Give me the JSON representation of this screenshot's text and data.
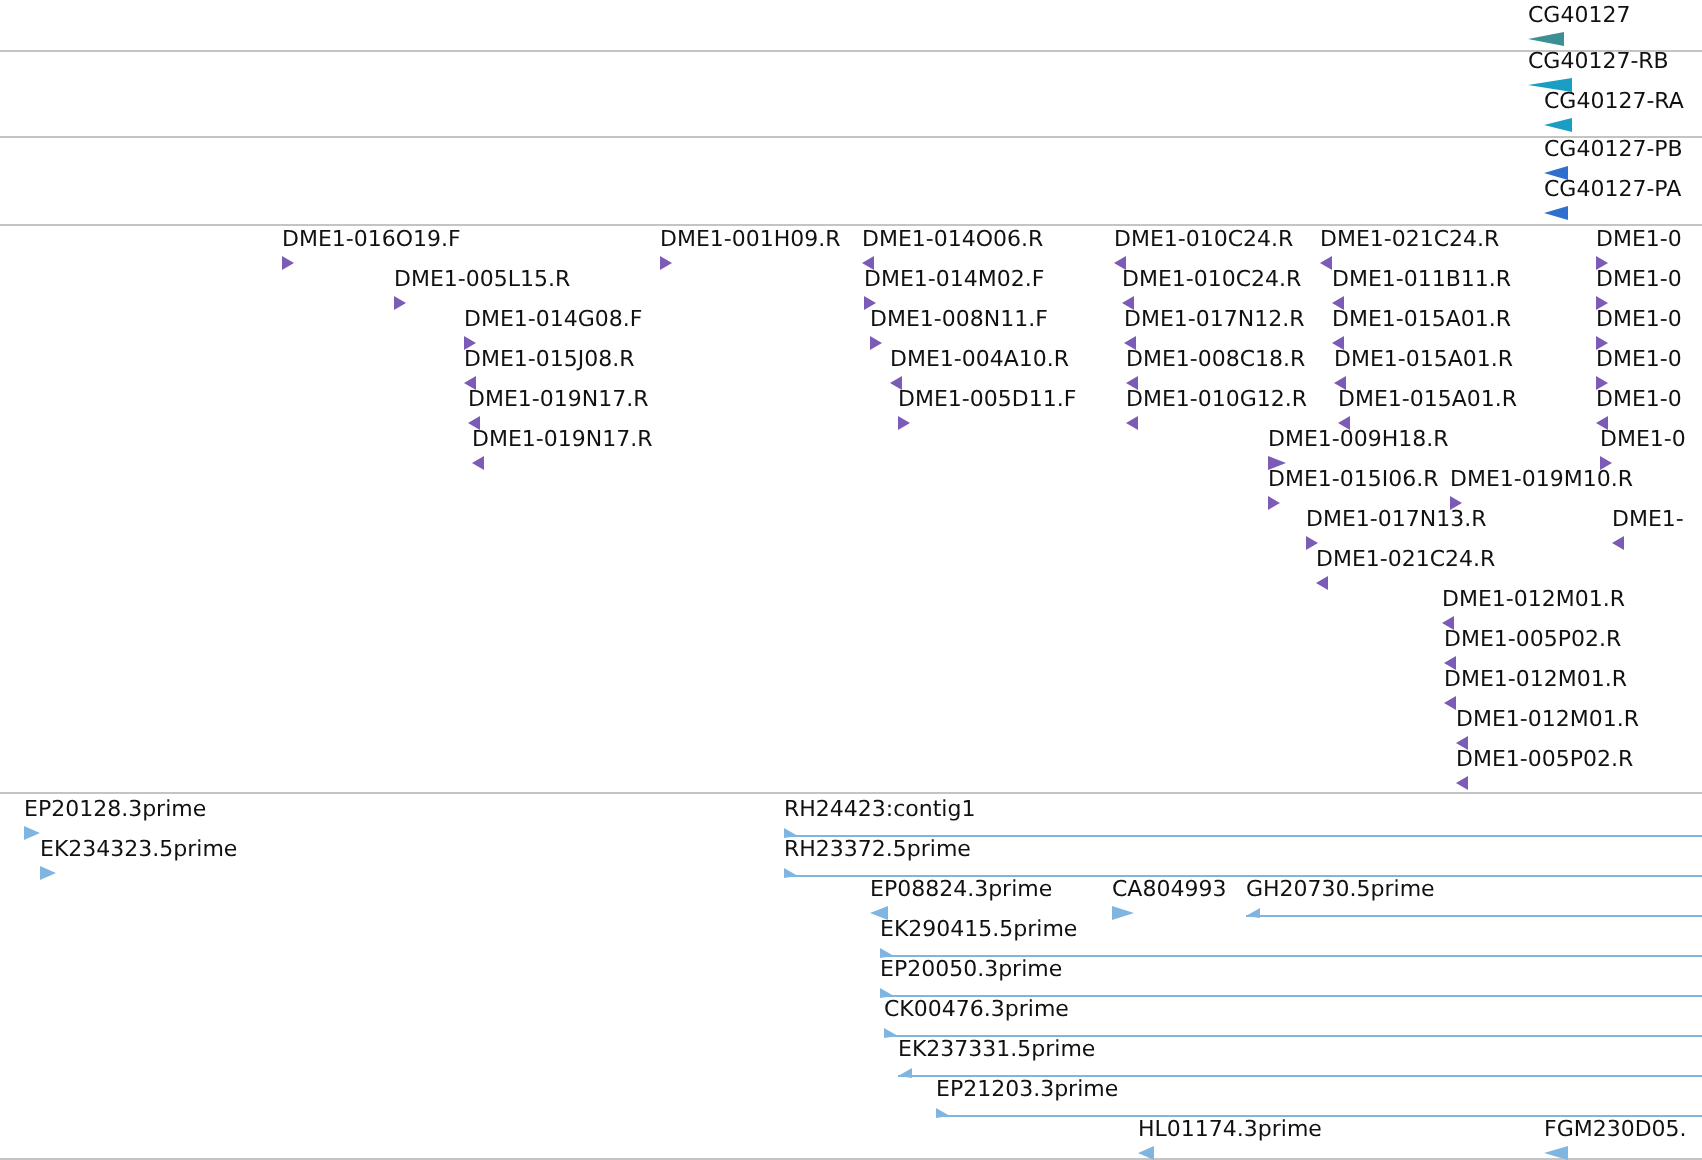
{
  "tracks": [
    {
      "kind": "gene",
      "features": [
        {
          "label": "CG40127",
          "reverse_strand": true
        }
      ]
    },
    {
      "kind": "transcript",
      "features": [
        {
          "label": "CG40127-RB",
          "reverse_strand": true
        },
        {
          "label": "CG40127-RA",
          "reverse_strand": true
        }
      ]
    },
    {
      "kind": "protein",
      "features": [
        {
          "label": "CG40127-PB",
          "reverse_strand": true
        },
        {
          "label": "CG40127-PA",
          "reverse_strand": true
        }
      ]
    },
    {
      "kind": "bac_end",
      "features": [
        {
          "label": "DME1-016O19.F",
          "reverse_strand": false
        },
        {
          "label": "DME1-005L15.R",
          "reverse_strand": false
        },
        {
          "label": "DME1-014G08.F",
          "reverse_strand": false
        },
        {
          "label": "DME1-015J08.R",
          "reverse_strand": true
        },
        {
          "label": "DME1-019N17.R",
          "reverse_strand": true
        },
        {
          "label": "DME1-019N17.R",
          "reverse_strand": true
        },
        {
          "label": "DME1-001H09.R",
          "reverse_strand": false
        },
        {
          "label": "DME1-014O06.R",
          "reverse_strand": true
        },
        {
          "label": "DME1-014M02.F",
          "reverse_strand": false
        },
        {
          "label": "DME1-008N11.F",
          "reverse_strand": false
        },
        {
          "label": "DME1-004A10.R",
          "reverse_strand": true
        },
        {
          "label": "DME1-005D11.F",
          "reverse_strand": false
        },
        {
          "label": "DME1-010C24.R",
          "reverse_strand": true
        },
        {
          "label": "DME1-021C24.R",
          "reverse_strand": true
        },
        {
          "label": "DME1-010C24.R",
          "reverse_strand": true
        },
        {
          "label": "DME1-011B11.R",
          "reverse_strand": true
        },
        {
          "label": "DME1-017N12.R",
          "reverse_strand": true
        },
        {
          "label": "DME1-015A01.R",
          "reverse_strand": true
        },
        {
          "label": "DME1-008C18.R",
          "reverse_strand": true
        },
        {
          "label": "DME1-015A01.R",
          "reverse_strand": true
        },
        {
          "label": "DME1-010G12.R",
          "reverse_strand": true
        },
        {
          "label": "DME1-015A01.R",
          "reverse_strand": true
        },
        {
          "label": "DME1-009H18.R",
          "reverse_strand": false
        },
        {
          "label": "DME1-015I06.R",
          "reverse_strand": false
        },
        {
          "label": "DME1-019M10.R",
          "reverse_strand": false
        },
        {
          "label": "DME1-017N13.R",
          "reverse_strand": false
        },
        {
          "label": "DME1-021C24.R",
          "reverse_strand": true
        },
        {
          "label": "DME1-012M01.R",
          "reverse_strand": true
        },
        {
          "label": "DME1-005P02.R",
          "reverse_strand": true
        },
        {
          "label": "DME1-012M01.R",
          "reverse_strand": true
        },
        {
          "label": "DME1-012M01.R",
          "reverse_strand": true
        },
        {
          "label": "DME1-005P02.R",
          "reverse_strand": true
        },
        {
          "label": "DME1-0",
          "reverse_strand": false
        },
        {
          "label": "DME1-0",
          "reverse_strand": false
        },
        {
          "label": "DME1-0",
          "reverse_strand": false
        },
        {
          "label": "DME1-0",
          "reverse_strand": false
        },
        {
          "label": "DME1-0",
          "reverse_strand": true
        },
        {
          "label": "DME1-0",
          "reverse_strand": false
        },
        {
          "label": "DME1-",
          "reverse_strand": true
        }
      ]
    },
    {
      "kind": "est",
      "features": [
        {
          "label": "EP20128.3prime",
          "reverse_strand": false
        },
        {
          "label": "EK234323.5prime",
          "reverse_strand": false
        },
        {
          "label": "RH24423:contig1",
          "reverse_strand": false
        },
        {
          "label": "RH23372.5prime",
          "reverse_strand": false
        },
        {
          "label": "EP08824.3prime",
          "reverse_strand": true
        },
        {
          "label": "CA804993",
          "reverse_strand": false
        },
        {
          "label": "GH20730.5prime",
          "reverse_strand": true
        },
        {
          "label": "EK290415.5prime",
          "reverse_strand": false
        },
        {
          "label": "EP20050.3prime",
          "reverse_strand": false
        },
        {
          "label": "CK00476.3prime",
          "reverse_strand": false
        },
        {
          "label": "EK237331.5prime",
          "reverse_strand": true
        },
        {
          "label": "EP21203.3prime",
          "reverse_strand": false
        },
        {
          "label": "HL01174.3prime",
          "reverse_strand": true
        },
        {
          "label": "FGM230D05.",
          "reverse_strand": true
        }
      ]
    }
  ]
}
